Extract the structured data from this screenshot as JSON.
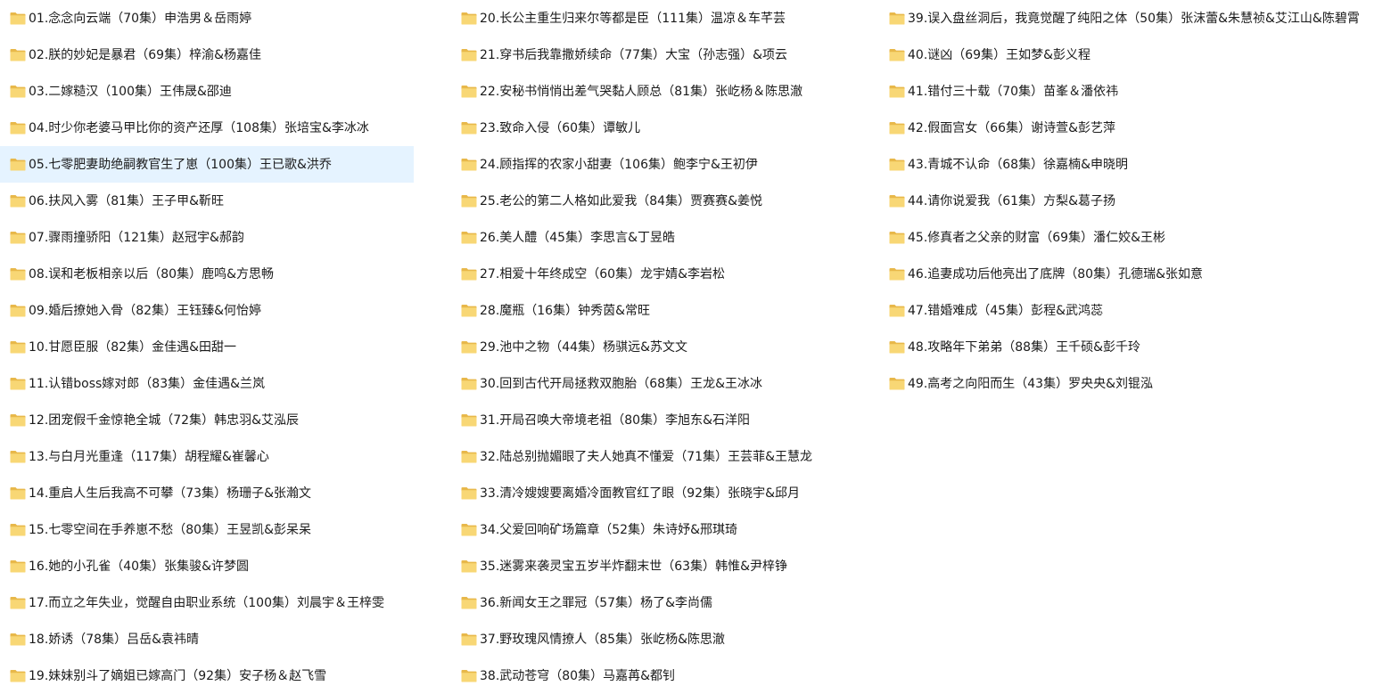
{
  "colors": {
    "folder_body": "#F8D775",
    "folder_back": "#E8B84A",
    "selection": "#E5F3FF",
    "text": "#1A1A1A"
  },
  "selected_index": 4,
  "folders": [
    "01.念念向云端（70集）申浩男＆岳雨婷",
    "02.朕的妙妃是暴君（69集）梓渝&杨嘉佳",
    "03.二嫁糙汉（100集）王伟晟&邵迪",
    "04.时少你老婆马甲比你的资产还厚（108集）张培宝&李冰冰",
    "05.七零肥妻助绝嗣教官生了崽（100集）王已歌&洪乔",
    "06.扶风入雾（81集）王子甲&靳旺",
    "07.骤雨撞骄阳（121集）赵冠宇&郝韵",
    "08.误和老板相亲以后（80集）鹿鸣&方思畅",
    "09.婚后撩她入骨（82集）王钰臻&何怡婷",
    "10.甘愿臣服（82集）金佳遇&田甜一",
    "11.认错boss嫁对郎（83集）金佳遇&兰岚",
    "12.团宠假千金惊艳全城（72集）韩忠羽&艾泓辰",
    "13.与白月光重逢（117集）胡程耀&崔馨心",
    "14.重启人生后我高不可攀（73集）杨珊子&张瀚文",
    "15.七零空间在手养崽不愁（80集）王昱凯&彭呆呆",
    "16.她的小孔雀（40集）张集骏&许梦圆",
    "17.而立之年失业，觉醒自由职业系统（100集）刘晨宇＆王梓雯",
    "18.娇诱（78集）吕岳&袁祎晴",
    "19.妹妹别斗了嫡姐已嫁高门（92集）安子杨＆赵飞雪",
    "20.长公主重生归来尔等都是臣（111集）温凉＆车芊芸",
    "21.穿书后我靠撒娇续命（77集）大宝（孙志强）&项云",
    "22.安秘书悄悄出差气哭黏人顾总（81集）张屹杨＆陈思澈",
    "23.致命入侵（60集）谭敏儿",
    "24.顾指挥的农家小甜妻（106集）鲍李宁&王初伊",
    "25.老公的第二人格如此爱我（84集）贾赛赛&姜悦",
    "26.美人醴（45集）李思言&丁昱皓",
    "27.相爱十年终成空（60集）龙宇婧&李岩松",
    "28.魔瓶（16集）钟秀茵&常旺",
    "29.池中之物（44集）杨骐远&苏文文",
    "30.回到古代开局拯救双胞胎（68集）王龙&王冰冰",
    "31.开局召唤大帝境老祖（80集）李旭东&石洋阳",
    "32.陆总别抛媚眼了夫人她真不懂爱（71集）王芸菲&王慧龙",
    "33.清冷嫂嫂要离婚冷面教官红了眼（92集）张晓宇&邱月",
    "34.父爱回响矿场篇章（52集）朱诗妤&邢琪琦",
    "35.迷雾来袭灵宝五岁半炸翻末世（63集）韩惟&尹梓铮",
    "36.新闻女王之罪冠（57集）杨了&李尚儒",
    "37.野玫瑰风情撩人（85集）张屹杨&陈思澈",
    "38.武动苍穹（80集）马嘉苒&都钊",
    "39.误入盘丝洞后，我竟觉醒了纯阳之体（50集）张沫蕾&朱慧祯&艾江山&陈碧霄",
    "40.谜凶（69集）王如梦&彭义程",
    "41.错付三十载（70集）苗峯＆潘依祎",
    "42.假面宫女（66集）谢诗萱&彭艺萍",
    "43.青城不认命（68集）徐嘉楠&申晓明",
    "44.请你说爱我（61集）方梨&葛子扬",
    "45.修真者之父亲的财富（69集）潘仁姣&王彬",
    "46.追妻成功后他亮出了底牌（80集）孔德瑞&张如意",
    "47.错婚难成（45集）彭程&武鸿蕊",
    "48.攻略年下弟弟（88集）王千硕&彭千玲",
    "49.高考之向阳而生（43集）罗央央&刘锟泓"
  ]
}
